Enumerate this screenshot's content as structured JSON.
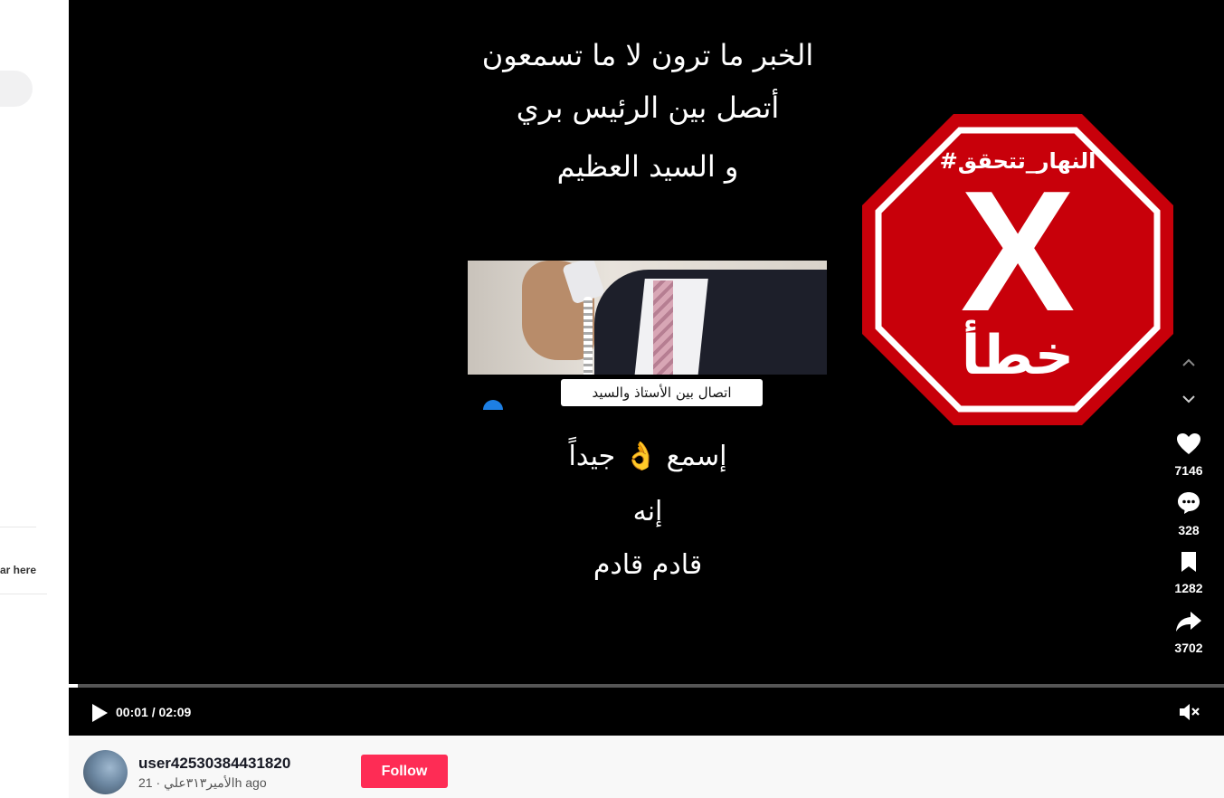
{
  "left_rail": {
    "partial_text": "ar here"
  },
  "video": {
    "top_text": [
      "الخبر ما ترون لا ما تسمعون",
      "أتصل بين الرئيس بري",
      "و السيد العظيم"
    ],
    "embedded_caption": "اتصال بين الأستاذ والسيد",
    "bottom_text": [
      "إسمع 👌 جيداً",
      "إنه",
      "قادم قادم"
    ],
    "badge": {
      "tag": "#النهار_تتحقق",
      "mark": "X",
      "word": "خطأ",
      "color": "#c8000a"
    },
    "progress": {
      "current": "00:01",
      "total": "02:09",
      "display": "00:01 / 02:09",
      "fraction": 0.008
    }
  },
  "actions": {
    "likes": "7146",
    "comments": "328",
    "saves": "1282",
    "shares": "3702",
    "icons": [
      "chevron-up-icon",
      "chevron-down-icon",
      "heart-icon",
      "comment-icon",
      "bookmark-icon",
      "share-icon",
      "play-icon",
      "mute-icon"
    ]
  },
  "creator": {
    "username": "user42530384431820",
    "nickname": "الأمير٣١٣علي",
    "posted": "21h ago",
    "subline": "الأمير٣١٣علي · 21h ago",
    "follow_label": "Follow",
    "follow_color": "#fe2c55"
  }
}
